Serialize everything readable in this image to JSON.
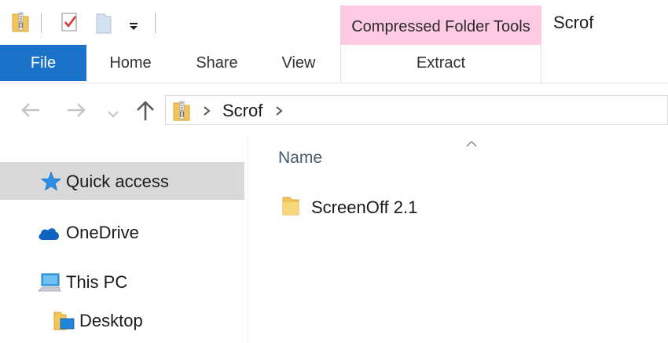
{
  "titlebar": {
    "context_tab_group": "Compressed Folder Tools",
    "window_title": "Scrof",
    "qat_icons": [
      "zip-folder-icon",
      "properties-icon",
      "new-folder-icon",
      "customize-dropdown-icon"
    ]
  },
  "ribbon": {
    "tabs": [
      {
        "label": "File"
      },
      {
        "label": "Home"
      },
      {
        "label": "Share"
      },
      {
        "label": "View"
      },
      {
        "label": "Extract"
      }
    ],
    "accent_color": "#1a73c9",
    "context_color": "#fec9e2"
  },
  "address": {
    "breadcrumb": [
      "Scrof"
    ],
    "icons": [
      "back-arrow-icon",
      "forward-arrow-icon",
      "recent-locations-icon",
      "up-arrow-icon",
      "zip-folder-icon",
      "chevron-right-icon"
    ]
  },
  "navigation": {
    "items": [
      {
        "label": "Quick access",
        "icon": "star-icon",
        "selected": true
      },
      {
        "label": "OneDrive",
        "icon": "cloud-icon"
      },
      {
        "label": "This PC",
        "icon": "computer-icon"
      },
      {
        "label": "Desktop",
        "icon": "desktop-folder-icon"
      }
    ]
  },
  "content": {
    "columns": [
      "Name"
    ],
    "files": [
      {
        "name": "ScreenOff 2.1",
        "icon": "folder-icon"
      }
    ]
  }
}
